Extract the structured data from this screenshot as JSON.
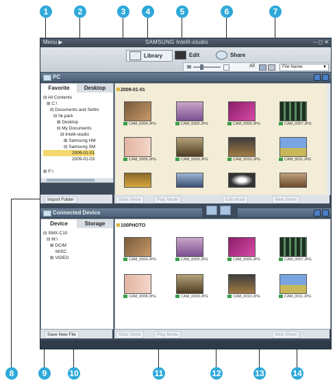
{
  "callouts": [
    "1",
    "2",
    "3",
    "4",
    "5",
    "6",
    "7",
    "8",
    "9",
    "10",
    "11",
    "12",
    "13",
    "14"
  ],
  "window": {
    "menu": "Menu ▶",
    "title": "SAMSUNG Intelli-studio",
    "controls": "– ◻ ✕"
  },
  "modes": {
    "library": "Library",
    "edit": "Edit",
    "share": "Share"
  },
  "toolbar": {
    "all": "All",
    "sort_value": "File Name"
  },
  "pc_pane": {
    "header": "PC",
    "tabs": [
      "Favorite",
      "Desktop"
    ],
    "tree": [
      "⊟ All Contents",
      "⊞ C:\\",
      "⊟ Documents and Settin",
      "⊟ hk.park",
      "⊞ Desktop",
      "⊟ My Documents",
      "⊟ Intelli-studio",
      "⊞ Samsung HM",
      "⊟ Samsung SM",
      "2009-01-01",
      "2009-01-03",
      "⊞ F:\\"
    ],
    "import_folder": "Import Folder",
    "folder_title": "2009-01-01",
    "files": [
      "CAM_0004.JPG",
      "CAM_0005.JPG",
      "CAM_0006.JPG",
      "CAM_0007.JPG",
      "CAM_0008.JPG",
      "CAM_0009.JPG",
      "CAM_0010.JPG",
      "CAM_0011.JPG"
    ],
    "bottom": {
      "slide_show": "Slide Show",
      "play_mode": "Play Mode",
      "edit_mode": "Edit Mode",
      "web_share": "Web Share"
    }
  },
  "device_pane": {
    "header": "Connected Device",
    "tabs": [
      "Device",
      "Storage"
    ],
    "tree": [
      "⊟ SMX-C10",
      "⊟ M:\\",
      "⊞ DCIM",
      "MISC",
      "⊞ VIDEO"
    ],
    "save_new_file": "Save New File",
    "folder_title": "100PHOTO",
    "files": [
      "CAM_0004.JPG",
      "CAM_0005.JPG",
      "CAM_0006.JPG",
      "CAM_0007.JPG",
      "CAM_0008.JPG",
      "CAM_0009.JPG",
      "CAM_0010.JPG",
      "CAM_0011.JPG"
    ],
    "bottom": {
      "slide_show": "Slide Show",
      "play_mode": "Play Mode",
      "web_share": "Web Share"
    }
  },
  "colors": {
    "callout": "#2ea9d9",
    "app_bg": "#3c4a5a",
    "pane_header": "#5a6e86",
    "main_bg": "#f3ecd6"
  }
}
